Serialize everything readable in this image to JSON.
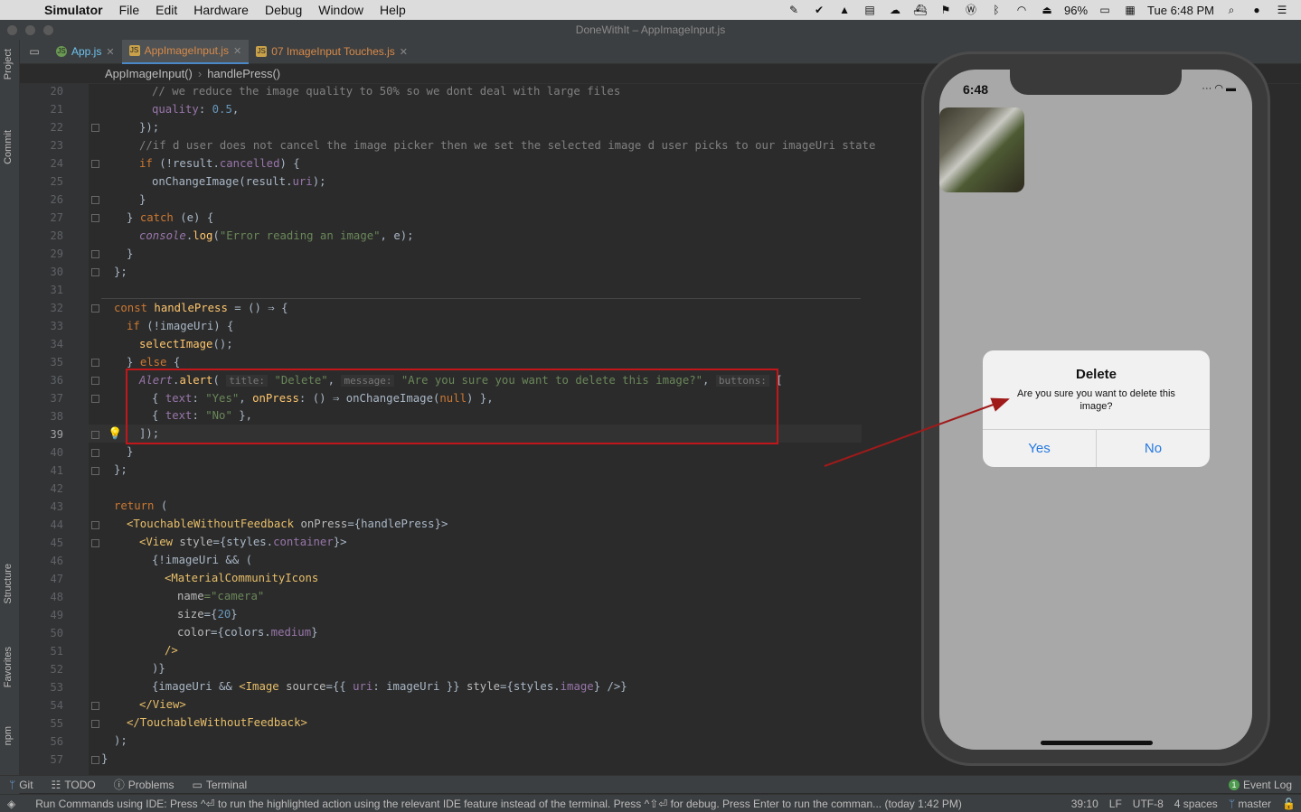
{
  "menubar": {
    "app": "Simulator",
    "items": [
      "File",
      "Edit",
      "Hardware",
      "Debug",
      "Window",
      "Help"
    ],
    "battery": "96%",
    "clock": "Tue 6:48 PM"
  },
  "window": {
    "title": "DoneWithIt – AppImageInput.js"
  },
  "sidebar": {
    "project": "Project",
    "commit": "Commit",
    "structure": "Structure",
    "favorites": "Favorites",
    "npm": "npm"
  },
  "tabs": [
    {
      "label": "App.js"
    },
    {
      "label": "AppImageInput.js"
    },
    {
      "label": "07 ImageInput Touches.js"
    }
  ],
  "breadcrumb": {
    "a": "AppImageInput()",
    "b": "handlePress()"
  },
  "line_numbers": [
    "20",
    "21",
    "22",
    "23",
    "24",
    "25",
    "26",
    "27",
    "28",
    "29",
    "30",
    "31",
    "32",
    "33",
    "34",
    "35",
    "36",
    "37",
    "38",
    "39",
    "40",
    "41",
    "42",
    "43",
    "44",
    "45",
    "46",
    "47",
    "48",
    "49",
    "50",
    "51",
    "52",
    "53",
    "54",
    "55",
    "56",
    "57"
  ],
  "code": {
    "l20": "// we reduce the image quality to 50% so we dont deal with large files",
    "l21a": "quality",
    "l21b": "0.5",
    "l22": "});",
    "l23": "//if d user does not cancel the image picker then we set the selected image d user picks to our imageUri state",
    "l24a": "if",
    "l24b": " (!result.",
    "l24c": "cancelled",
    "l24d": ") {",
    "l25a": "onChangeImage",
    "l25b": "(result.",
    "l25c": "uri",
    "l25d": ");",
    "l26": "}",
    "l27a": "} ",
    "l27b": "catch",
    "l27c": " (e) {",
    "l28a": "console",
    "l28b": ".",
    "l28c": "log",
    "l28d": "(",
    "l28e": "\"Error reading an image\"",
    "l28f": ", e);",
    "l29": "}",
    "l30": "};",
    "l32a": "const ",
    "l32b": "handlePress",
    "l32c": " = () ⇒ {",
    "l33a": "if",
    "l33b": " (!imageUri) {",
    "l34a": "selectImage",
    "l34b": "();",
    "l35a": "} ",
    "l35b": "else",
    "l35c": " {",
    "l36a": "Alert",
    "l36b": ".",
    "l36c": "alert",
    "l36d": "(",
    "l36h1": "title:",
    "l36e": "\"Delete\"",
    "l36h2": "message:",
    "l36f": "\"Are you sure you want to delete this image?\"",
    "l36h3": "buttons:",
    "l36g": "[",
    "l37a": "{ ",
    "l37b": "text",
    "l37c": ": ",
    "l37d": "\"Yes\"",
    "l37e": ", ",
    "l37f": "onPress",
    "l37g": ": () ⇒ ",
    "l37h": "onChangeImage",
    "l37i": "(",
    "l37j": "null",
    "l37k": ") },",
    "l38a": "{ ",
    "l38b": "text",
    "l38c": ": ",
    "l38d": "\"No\"",
    "l38e": " },",
    "l39": "]);",
    "l40": "}",
    "l41": "};",
    "l43a": "return",
    "l43b": " (",
    "l44a": "<TouchableWithoutFeedback",
    "l44b": " onPress",
    "l44c": "={handlePress}>",
    "l45a": "<View",
    "l45b": " style",
    "l45c": "={styles.",
    "l45d": "container",
    "l45e": "}>",
    "l46a": "{!imageUri && (",
    "l47a": "<MaterialCommunityIcons",
    "l48a": "name",
    "l48b": "=\"camera\"",
    "l49a": "size",
    "l49b": "={",
    "l49c": "20",
    "l49d": "}",
    "l50a": "color",
    "l50b": "={colors.",
    "l50c": "medium",
    "l50d": "}",
    "l51": "/>",
    "l52": ")}",
    "l53a": "{imageUri && ",
    "l53b": "<Image",
    "l53c": " source",
    "l53d": "={{ ",
    "l53e": "uri",
    "l53f": ": imageUri }}",
    "l53g": " style",
    "l53h": "={styles.",
    "l53i": "image",
    "l53j": "} />}",
    "l54": "</View>",
    "l55": "</TouchableWithoutFeedback>",
    "l56": ");",
    "l57": "}"
  },
  "bottom_tools": {
    "git": "Git",
    "todo": "TODO",
    "problems": "Problems",
    "terminal": "Terminal",
    "event_log": "Event Log",
    "event_count": "1"
  },
  "status": {
    "message": "Run Commands using IDE: Press ^⏎ to run the highlighted action using the relevant IDE feature instead of the terminal. Press ^⇧⏎ for debug. Press Enter to run the comman... (today 1:42 PM)",
    "position": "39:10",
    "line_sep": "LF",
    "encoding": "UTF-8",
    "indent": "4 spaces",
    "branch": "master"
  },
  "phone": {
    "time": "6:48",
    "alert": {
      "title": "Delete",
      "message": "Are you sure you want to delete this image?",
      "yes": "Yes",
      "no": "No"
    }
  },
  "colors": {
    "annotation": "#c2171a",
    "ios_blue": "#2479e0"
  }
}
